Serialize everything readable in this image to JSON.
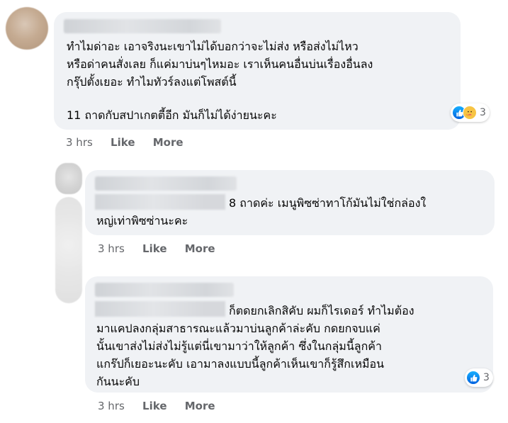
{
  "comments": [
    {
      "lines": [
        "ทำไมด่าอะ เอาจริงนะเขาไม่ได้บอกว่าจะไม่ส่ง หรือส่งไม่ไหว",
        "หรือด่าคนสั่งเลย ก็แค่มาบ่นๆไหมอะ เราเห็นคนอื่นบ่นเรื่องอื่นลง",
        "กรุ๊ปตั้งเยอะ ทำไมทัวร์ลงแต่โพสต์นี้",
        "",
        "11 ถาดกับสปาเกตตี้อีก มันก็ไม่ได้ง่ายนะคะ"
      ],
      "reaction_count": "3",
      "reaction_icons": [
        "like-icon",
        "care-icon"
      ],
      "time": "3 hrs",
      "like_label": "Like",
      "more_label": "More"
    },
    {
      "lines": [
        "8 ถาดค่ะ เมนูพิซซ่าทาโก้มันไม่ใช่กล่องใ",
        "หญ่เท่าพิซซ่านะคะ"
      ],
      "time": "3 hrs",
      "like_label": "Like",
      "more_label": "More"
    },
    {
      "lines": [
        "ก็ตดยกเลิกสิคับ ผมก็ไรเดอร์ ทำไมต้อง",
        "มาแคปลงกลุ่มสาธารณะแล้วมาบ่นลูกค้าล่ะคับ กดยกจบแค่",
        "นั้นเขาส่งไม่ส่งไม่รู้แต่นี่เขามาว่าให้ลูกค้า ซึ่งในกลุ่มนี้ลูกค้า",
        "แกร๊ปก็เยอะนะคับ เอามาลงแบบนี้ลูกค้าเห็นเขาก็รู้สึกเหมือน",
        "กันนะคับ"
      ],
      "reaction_count": "3",
      "reaction_icons": [
        "like-icon"
      ],
      "time": "3 hrs",
      "like_label": "Like",
      "more_label": "More"
    }
  ],
  "colors": {
    "bubble": "#f0f2f5",
    "meta_text": "#65676b",
    "like_blue": "#1877f2"
  }
}
